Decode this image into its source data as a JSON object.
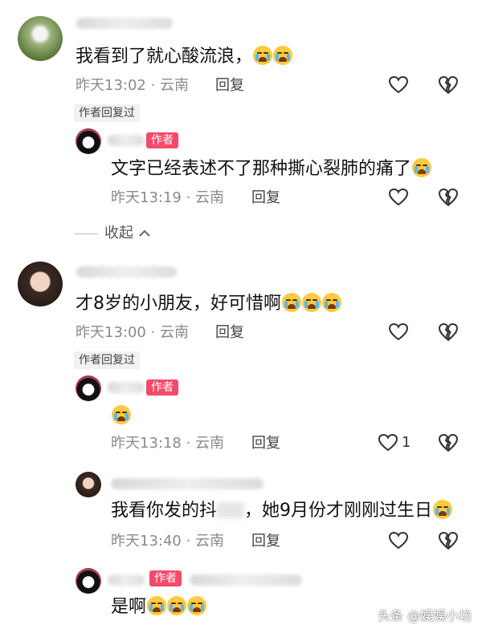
{
  "comments": [
    {
      "text": "我看到了就心酸流浪，",
      "time": "昨天13:02 · 云南",
      "reply_label": "回复",
      "author_replied": "作者回复过",
      "replies": [
        {
          "author_badge": "作者",
          "text": "文字已经表述不了那种撕心裂肺的痛了",
          "time": "昨天13:19 · 云南",
          "reply_label": "回复"
        }
      ],
      "collapse_label": "收起"
    },
    {
      "text": "才8岁的小朋友，好可惜啊",
      "time": "昨天13:00 · 云南",
      "reply_label": "回复",
      "author_replied": "作者回复过",
      "replies": [
        {
          "author_badge": "作者",
          "text": "",
          "time": "昨天13:18 · 云南",
          "reply_label": "回复",
          "like_count": "1"
        },
        {
          "text_part1": "我看你发的抖",
          "text_part2": "，她9月份才刚刚过生日",
          "time": "昨天13:40 · 云南",
          "reply_label": "回复"
        },
        {
          "author_badge": "作者",
          "text": "是啊"
        }
      ]
    }
  ],
  "watermark": "头条 @娱娱小坊",
  "colors": {
    "author_badge": "#f54a6a",
    "meta_text": "#8a8a8a"
  },
  "icons": [
    "heart-outline-icon",
    "broken-heart-icon",
    "chevron-up-icon",
    "crying-emoji-icon"
  ]
}
